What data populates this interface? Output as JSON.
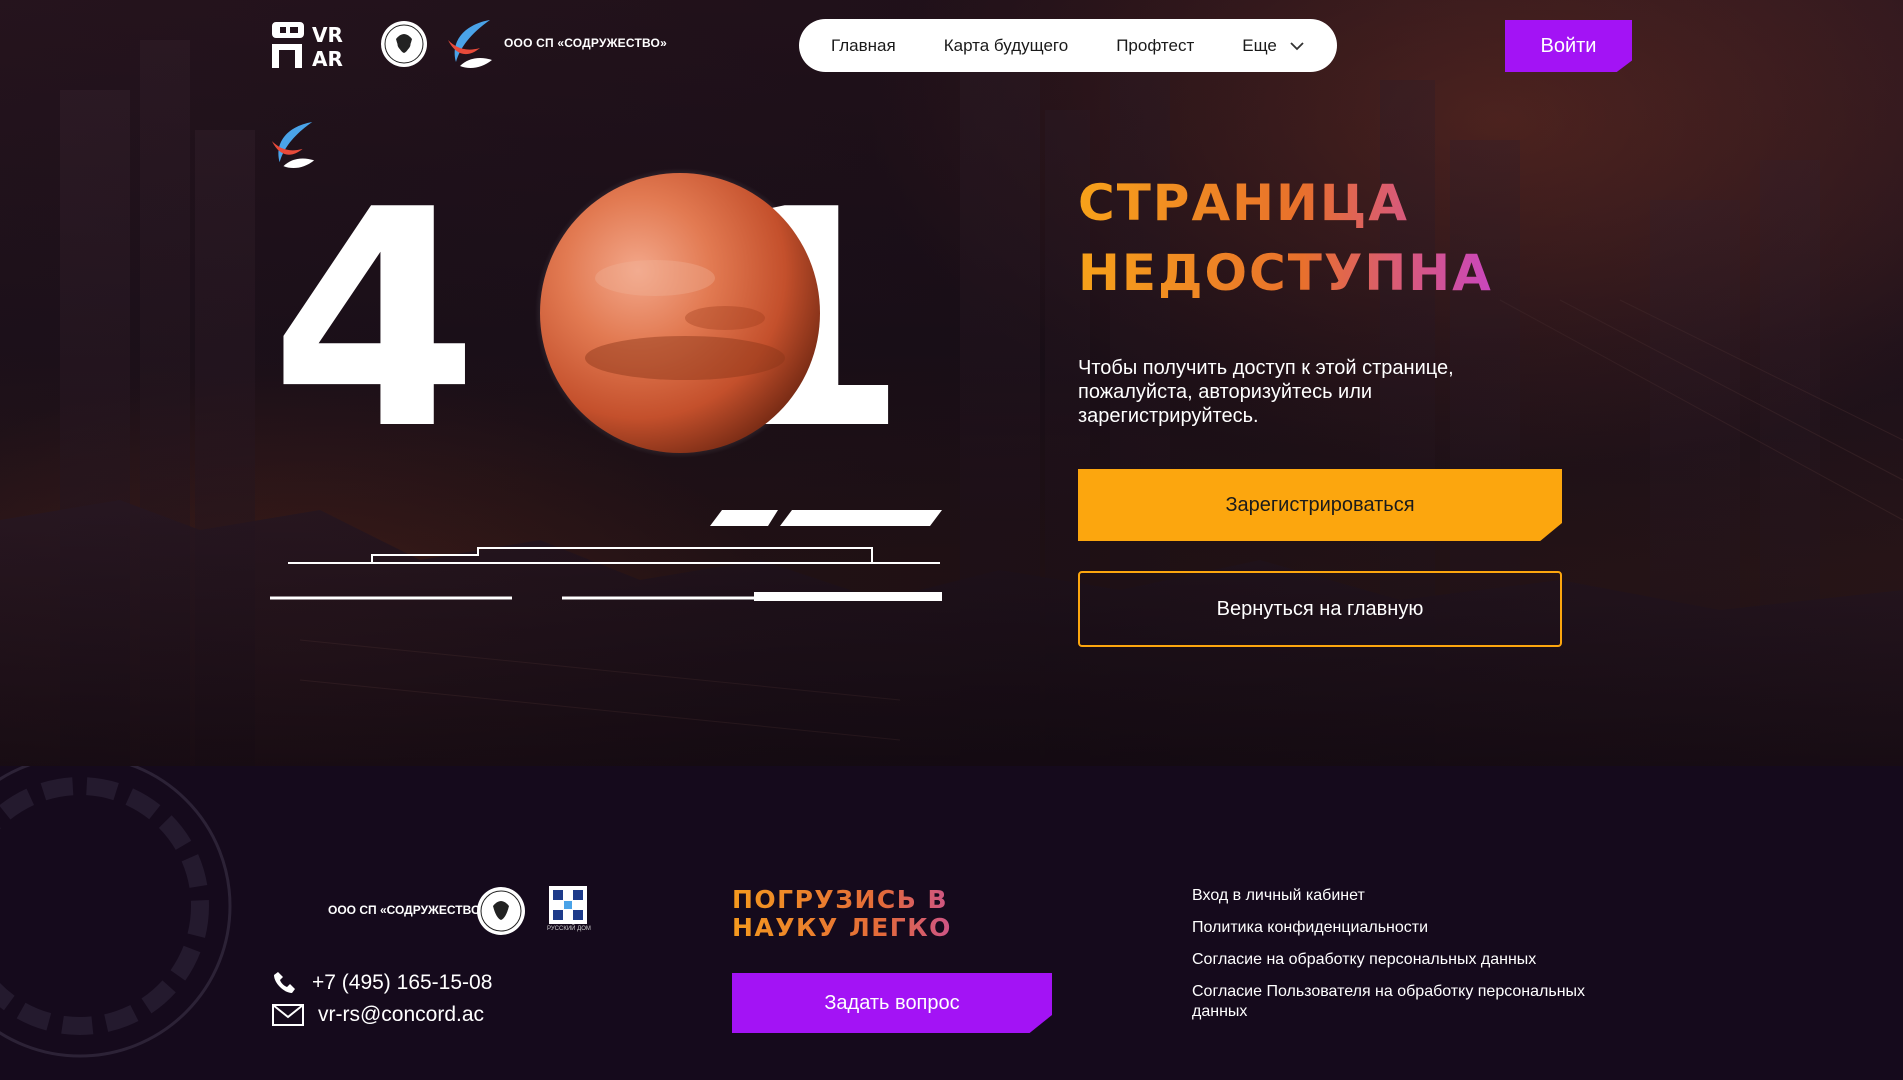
{
  "header": {
    "logo_vr_label": "VR AR",
    "org_name": "ООО СП «СОДРУЖЕСТВО»",
    "nav": [
      {
        "label": "Главная"
      },
      {
        "label": "Карта будущего"
      },
      {
        "label": "Профтест"
      },
      {
        "label": "Еще"
      }
    ],
    "login_label": "Войти"
  },
  "hero": {
    "code_left": "4",
    "code_right": "1",
    "title_line1": "СТРАНИЦА",
    "title_line2": "НЕДОСТУПНА",
    "description": "Чтобы получить доступ к этой странице, пожалуйста, авторизуйтесь или зарегистрируйтесь.",
    "register_label": "Зарегистрироваться",
    "home_label": "Вернуться на главную"
  },
  "footer": {
    "org_name": "ООО СП «СОДРУЖЕСТВО»",
    "rd_label": "РУССКИЙ ДОМ",
    "phone": "+7 (495) 165-15-08",
    "email": "vr-rs@concord.ac",
    "slogan_line1": "ПОГРУЗИСЬ В",
    "slogan_line2": "НАУКУ ЛЕГКО",
    "ask_label": "Задать вопрос",
    "links": [
      "Вход в личный кабинет",
      "Политика конфиденциальности",
      "Согласие на обработку персональных данных",
      "Согласие Пользователя на обработку персональных данных"
    ]
  },
  "colors": {
    "accent_purple": "#a313f5",
    "accent_orange": "#fca60e",
    "footer_bg": "#150a1c"
  }
}
